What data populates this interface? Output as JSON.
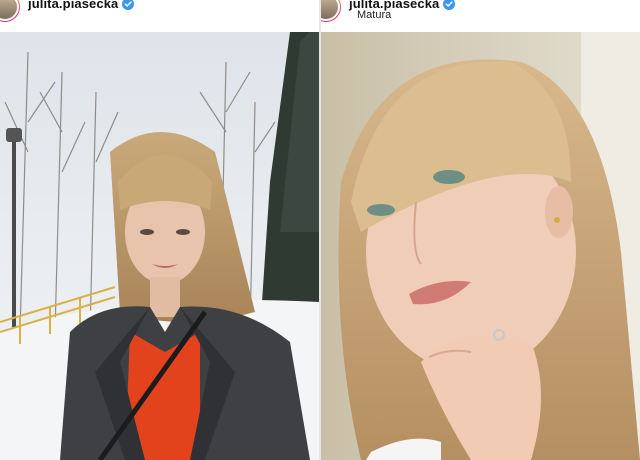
{
  "posts": [
    {
      "username": "julita.piasecka",
      "verified_icon": "verified-badge-icon",
      "subtitle": "",
      "photo": "snowy-forest-portrait-photo",
      "colors": {
        "verified": "#3897f0"
      }
    },
    {
      "username": "julita.piasecka",
      "verified_icon": "verified-badge-icon",
      "subtitle": "Matura",
      "photo": "indoor-selfie-photo",
      "colors": {
        "verified": "#3897f0"
      }
    }
  ]
}
